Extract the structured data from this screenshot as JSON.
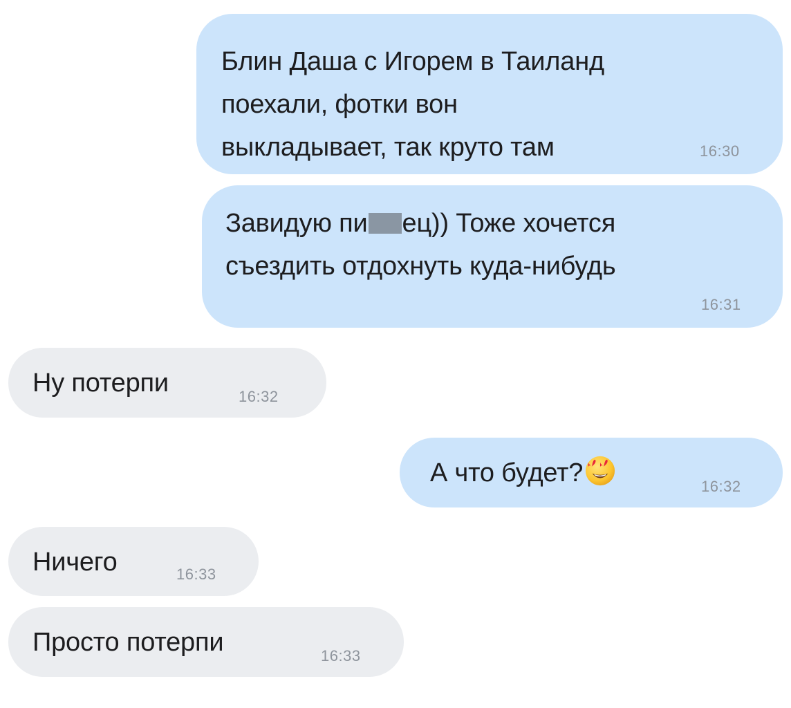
{
  "messages": [
    {
      "direction": "outgoing",
      "lines": [
        "Блин Даша с Игорем в Таиланд",
        "поехали, фотки вон",
        "выкладывает, так круто там"
      ],
      "time": "16:30"
    },
    {
      "direction": "outgoing",
      "line1_before": "Завидую пи",
      "line1_after": "ец)) Тоже хочется",
      "line2": "съездить отдохнуть куда-нибудь",
      "time": "16:31"
    },
    {
      "direction": "incoming",
      "text": "Ну потерпи",
      "time": "16:32"
    },
    {
      "direction": "outgoing",
      "text": "А что будет?",
      "emoji": "heart-eyes-emoji",
      "time": "16:32"
    },
    {
      "direction": "incoming",
      "text": "Ничего",
      "time": "16:33"
    },
    {
      "direction": "incoming",
      "text": "Просто потерпи",
      "time": "16:33"
    }
  ],
  "colors": {
    "outgoing_bubble": "#cce4fb",
    "incoming_bubble": "#ebedf0",
    "message_text": "#1d1d1f",
    "timestamp": "#8e949c",
    "censor_block": "#8a96a3"
  }
}
